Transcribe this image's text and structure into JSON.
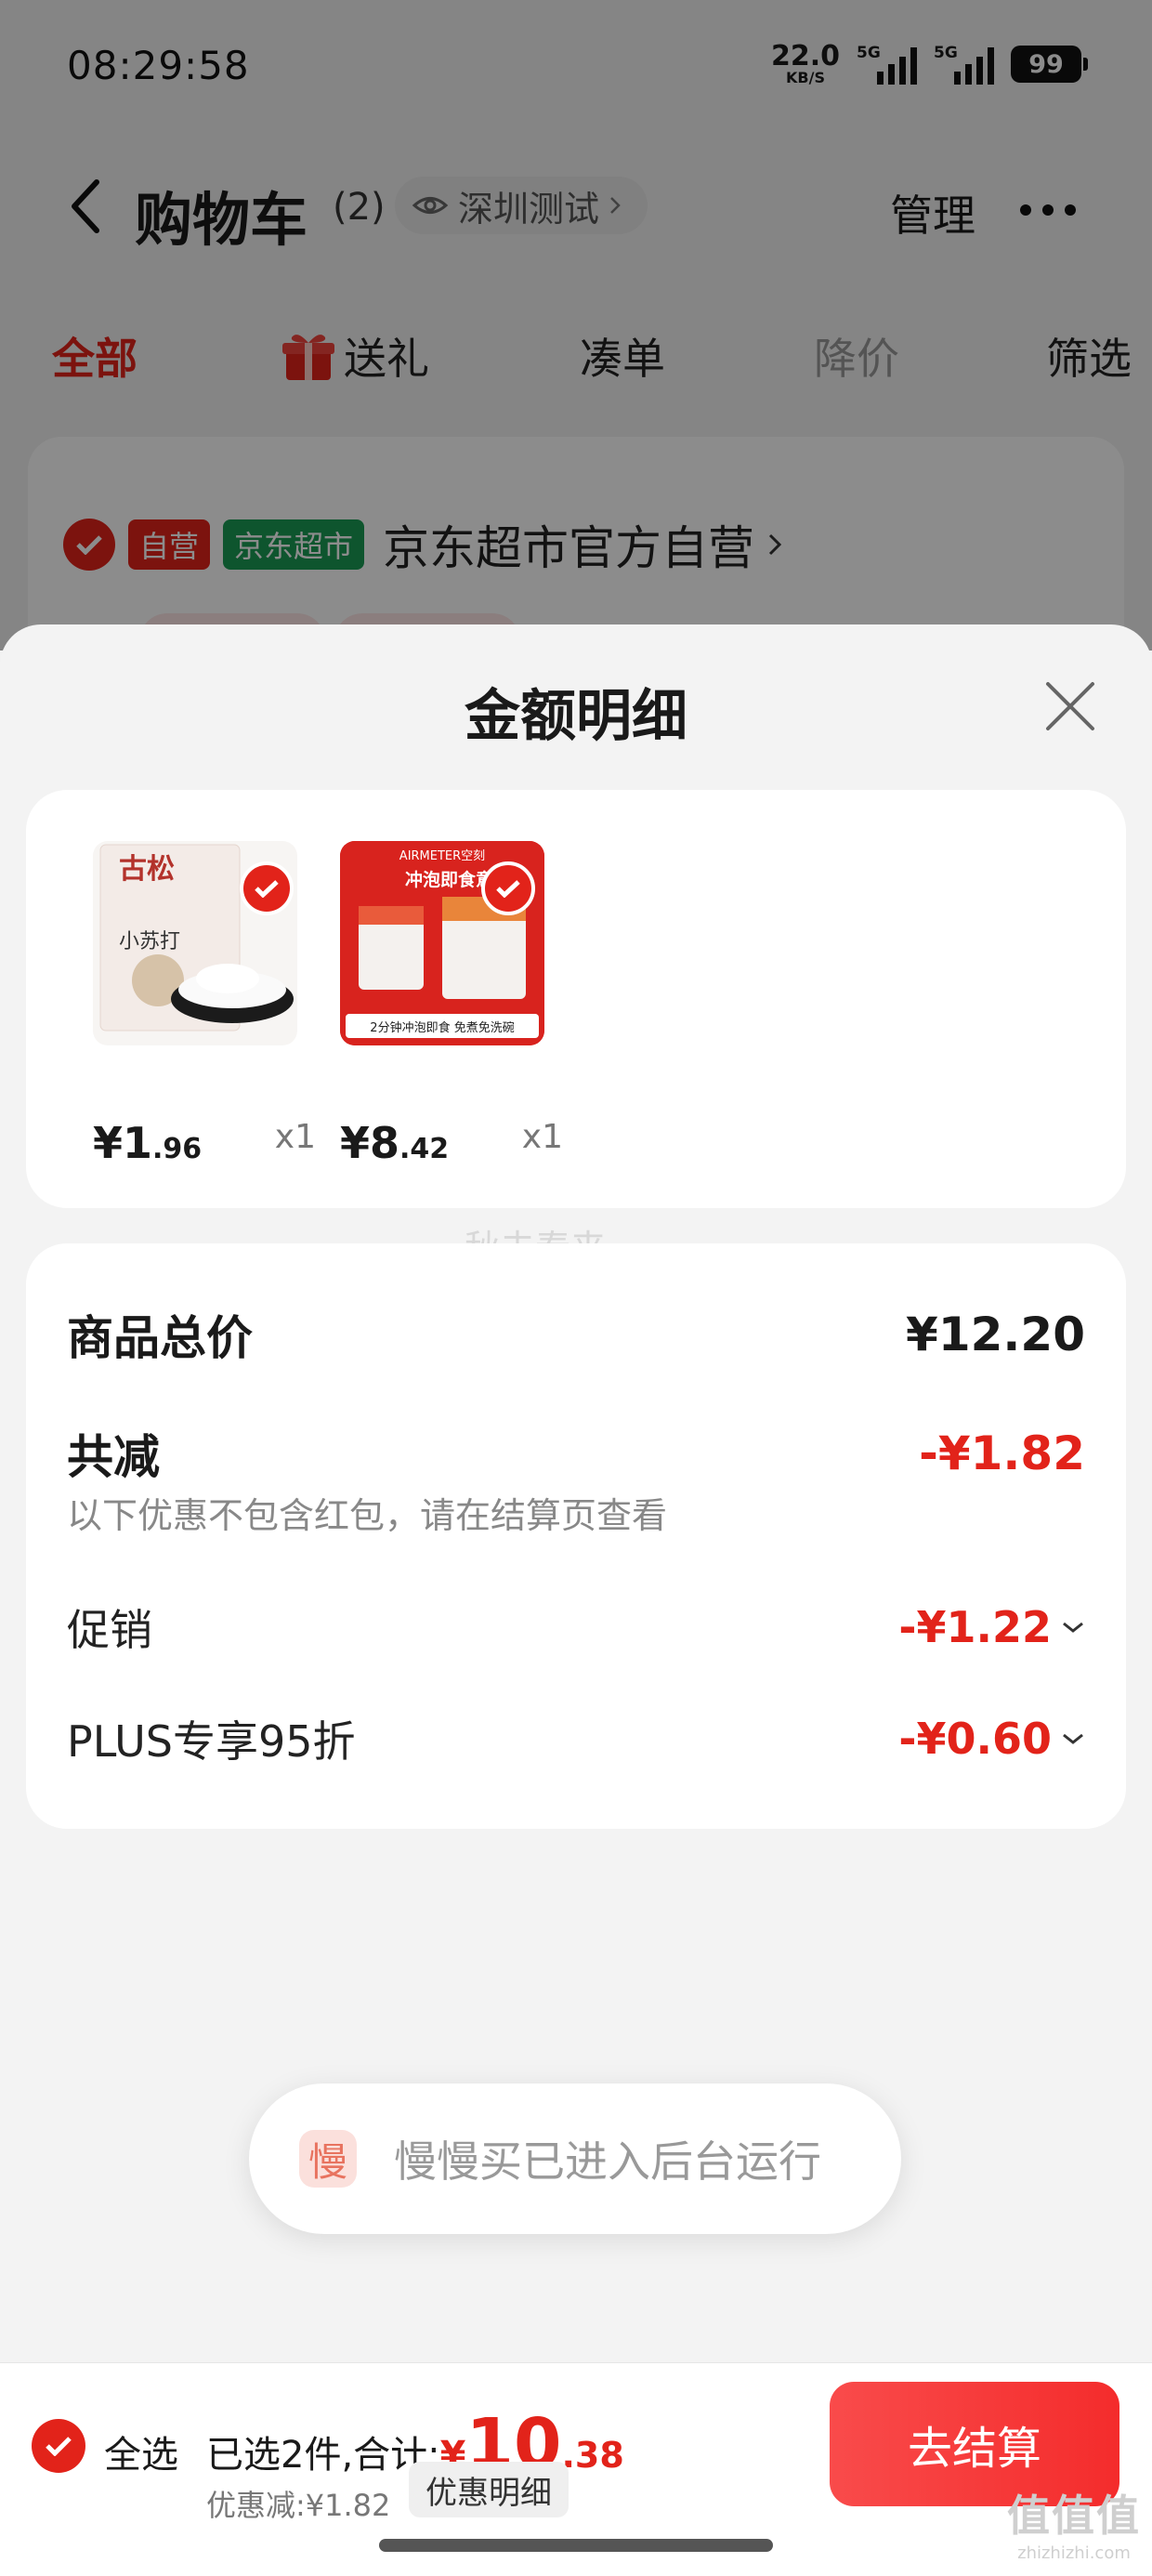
{
  "status_bar": {
    "time": "08:29:58",
    "net_speed": "22.0",
    "net_unit": "KB/S",
    "sim1": "5G",
    "sim2": "5G",
    "battery": "99"
  },
  "nav": {
    "title": "购物车",
    "count": "(2)",
    "location": "深圳测试",
    "manage": "管理"
  },
  "tabs": [
    {
      "label": "全部",
      "state": "active"
    },
    {
      "label": "送礼",
      "state": "normal",
      "icon": "gift-icon"
    },
    {
      "label": "凑单",
      "state": "normal"
    },
    {
      "label": "降价",
      "state": "muted"
    },
    {
      "label": "筛选",
      "state": "normal"
    }
  ],
  "store": {
    "tag_self": "自营",
    "tag_jd": "京东超市",
    "name": "京东超市官方自营"
  },
  "sheet": {
    "title": "金额明细",
    "items": [
      {
        "price_int": "¥1",
        "price_dec": ".96",
        "qty": "x1",
        "image": "baking-soda-package"
      },
      {
        "price_int": "¥8",
        "price_dec": ".42",
        "qty": "x1",
        "image": "instant-food-cups"
      }
    ],
    "item2_brand": "AIRMETER空刻",
    "item2_headline": "冲泡即食意面",
    "item2_caption": "2分钟冲泡即食 免煮免洗碗",
    "item1_pack_text": "小苏打",
    "watermark": "秋去春来",
    "summary": {
      "total_label": "商品总价",
      "total_value": "¥12.20",
      "reduce_label": "共减",
      "reduce_value": "-¥1.82",
      "note": "以下优惠不包含红包，请在结算页查看",
      "promo_label": "促销",
      "promo_value": "-¥1.22",
      "plus_label": "PLUS专享95折",
      "plus_value": "-¥0.60"
    }
  },
  "toast": {
    "icon_char": "慢",
    "text": "慢慢买已进入后台运行"
  },
  "bottom_bar": {
    "select_all": "全选",
    "selected_text": "已选2件,合计:",
    "currency": "¥",
    "total_int": "10",
    "total_dec": ".38",
    "discount": "优惠减:¥1.82",
    "detail_button": "优惠明细",
    "checkout": "去结算"
  },
  "corner_watermark": {
    "big": "值值值",
    "small": "zhizhizhi.com"
  },
  "colors": {
    "accent": "#e2231a",
    "jd_green": "#1b9c55",
    "checkout_gradient": "#f42c2c"
  }
}
